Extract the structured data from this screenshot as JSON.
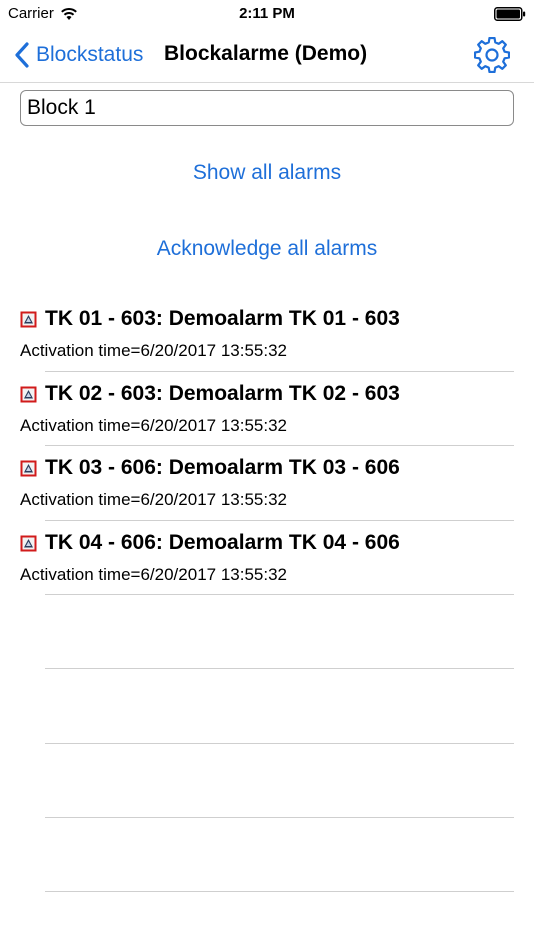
{
  "status_bar": {
    "carrier": "Carrier",
    "time": "2:11 PM",
    "wifi_icon": "wifi-icon",
    "battery_icon": "battery-icon"
  },
  "nav": {
    "back_label": "Blockstatus",
    "title": "Blockalarme (Demo)",
    "settings_icon": "gear-icon",
    "accent_color": "#1e6fd9"
  },
  "block_field": {
    "value": "Block 1"
  },
  "actions": {
    "show_all": "Show all alarms",
    "acknowledge_all": "Acknowledge all alarms"
  },
  "alarms": [
    {
      "title": "TK 01 - 603: Demoalarm TK 01 - 603",
      "time": "Activation time=6/20/2017 13:55:32",
      "icon": "alarm-warning-icon"
    },
    {
      "title": "TK 02 - 603: Demoalarm TK 02 - 603",
      "time": "Activation time=6/20/2017 13:55:32",
      "icon": "alarm-warning-icon"
    },
    {
      "title": "TK 03 - 606: Demoalarm TK 03 - 606",
      "time": "Activation time=6/20/2017 13:55:32",
      "icon": "alarm-warning-icon"
    },
    {
      "title": "TK 04 - 606: Demoalarm TK 04 - 606",
      "time": "Activation time=6/20/2017 13:55:32",
      "icon": "alarm-warning-icon"
    }
  ]
}
